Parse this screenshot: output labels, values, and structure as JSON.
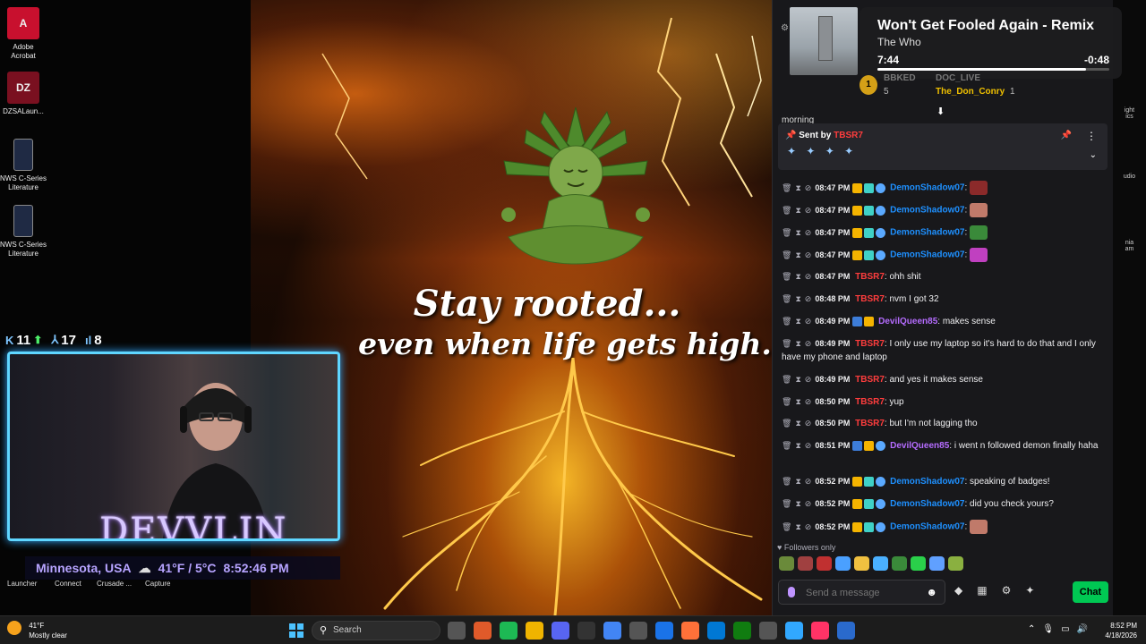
{
  "desktop": {
    "icons": [
      {
        "label": "Adobe\nAcrobat",
        "name": "acrobat",
        "glyph": "A"
      },
      {
        "label": "DZSALaun...",
        "name": "dzsalauncher",
        "glyph": "DZ"
      },
      {
        "label": "NWS C-Series\nLiterature",
        "name": "nws-1",
        "glyph": "N"
      },
      {
        "label": "NWS C-Series\nLiterature",
        "name": "nws-2",
        "glyph": "N"
      }
    ],
    "bottom_labels": [
      "Launcher",
      "Connect",
      "Crusade ...",
      "Capture"
    ]
  },
  "artwork": {
    "line1": "Stay rooted...",
    "line2": "even when life gets high."
  },
  "stream_overlay": {
    "stat1": "11",
    "stat2": "17",
    "stat3": "8",
    "cam_name": "DEVVLIN",
    "location": "Minnesota, USA",
    "weather": "41°F / 5°C",
    "time": "8:52:46 PM"
  },
  "now_playing": {
    "title": "Won't Get Fooled Again - Remix",
    "artist": "The Who",
    "elapsed": "7:44",
    "remaining": "-0:48",
    "progress_fraction": 0.9
  },
  "leaderboard": {
    "rank": "1",
    "user1": "BBKED",
    "count1": "5",
    "user2": "DOC_LIVE",
    "user3": "The_Don_Conry",
    "count3": "1"
  },
  "chat": {
    "partial_line": "morning",
    "pinned": {
      "sent_by_label": "Sent by",
      "sender": "TBSR7",
      "emotes": "✦ ✦ ✦ ✦"
    },
    "messages": [
      {
        "time": "08:47 PM",
        "user": "DemonShadow07",
        "ucls": "demon",
        "badges": [
          "crown",
          "sub",
          "star"
        ],
        "text": "",
        "emote": "#8b2a2a"
      },
      {
        "time": "08:47 PM",
        "user": "DemonShadow07",
        "ucls": "demon",
        "badges": [
          "crown",
          "sub",
          "star"
        ],
        "text": "",
        "emote": "#c07a6a"
      },
      {
        "time": "08:47 PM",
        "user": "DemonShadow07",
        "ucls": "demon",
        "badges": [
          "crown",
          "sub",
          "star"
        ],
        "text": "",
        "emote": "#3a8a3a"
      },
      {
        "time": "08:47 PM",
        "user": "DemonShadow07",
        "ucls": "demon",
        "badges": [
          "crown",
          "sub",
          "star"
        ],
        "text": "",
        "emote": "#c040c0"
      },
      {
        "time": "08:47 PM",
        "user": "TBSR7",
        "ucls": "tbsr",
        "badges": [],
        "text": "ohh shit"
      },
      {
        "time": "08:48 PM",
        "user": "TBSR7",
        "ucls": "tbsr",
        "badges": [],
        "text": "nvm I got 32"
      },
      {
        "time": "08:49 PM",
        "user": "DevilQueen85",
        "ucls": "devil",
        "badges": [
          "boost",
          "crown"
        ],
        "text": "makes sense"
      },
      {
        "time": "08:49 PM",
        "user": "TBSR7",
        "ucls": "tbsr",
        "badges": [],
        "text": "I only use my laptop so it's hard to do that and I only have my phone and laptop"
      },
      {
        "time": "08:49 PM",
        "user": "TBSR7",
        "ucls": "tbsr",
        "badges": [],
        "text": "and yes it makes sense"
      },
      {
        "time": "08:50 PM",
        "user": "TBSR7",
        "ucls": "tbsr",
        "badges": [],
        "text": "yup"
      },
      {
        "time": "08:50 PM",
        "user": "TBSR7",
        "ucls": "tbsr",
        "badges": [],
        "text": "but I'm not lagging tho"
      },
      {
        "time": "08:51 PM",
        "user": "DevilQueen85",
        "ucls": "devil",
        "badges": [
          "boost",
          "crown",
          "star"
        ],
        "text": "i went n followed demon finally haha"
      },
      {
        "time": "08:52 PM",
        "user": "DemonShadow07",
        "ucls": "demon",
        "badges": [
          "crown",
          "sub",
          "star"
        ],
        "text": "speaking of badges!"
      },
      {
        "time": "08:52 PM",
        "user": "DemonShadow07",
        "ucls": "demon",
        "badges": [
          "crown",
          "sub",
          "star"
        ],
        "text": "did you check yours?"
      },
      {
        "time": "08:52 PM",
        "user": "DemonShadow07",
        "ucls": "demon",
        "badges": [
          "crown",
          "sub",
          "star"
        ],
        "text": "",
        "emote": "#c07a6a"
      }
    ],
    "followers_only": "Followers only",
    "input_placeholder": "Send a message",
    "send_label": "Chat",
    "emote_colors": [
      "#6a8a3a",
      "#a04040",
      "#c03030",
      "#4aa0ff",
      "#f0c040",
      "#4ab0ff",
      "#3a8a3a",
      "#2ad04a",
      "#60a0ff",
      "#8ab040"
    ]
  },
  "right_strip": {
    "label1": "ight\nics",
    "label2": "udio",
    "label3": "nia\nam"
  },
  "taskbar": {
    "temp": "41°F",
    "condition": "Mostly clear",
    "search": "Search",
    "time": "8:52 PM",
    "date": "4/18/2026",
    "app_colors": [
      "#555",
      "#e05a2a",
      "#1db954",
      "#f0b400",
      "#5865f2",
      "#333",
      "#4285f4",
      "#555",
      "#1a73e8",
      "#ff7139",
      "#0078d4",
      "#107c10",
      "#555",
      "#31a8ff",
      "#ff3366",
      "#2a6acc"
    ]
  }
}
